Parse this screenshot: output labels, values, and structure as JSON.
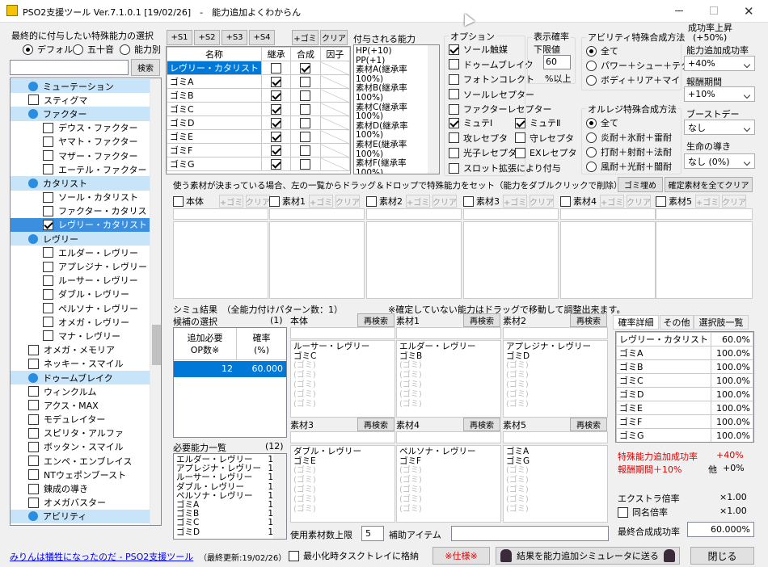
{
  "window": {
    "title": "PSO2支援ツール Ver.7.1.0.1 [19/02/26]　-　能力追加よくわからん"
  },
  "left": {
    "heading": "最終的に付与したい特殊能力の選択",
    "radios": [
      {
        "label": "デフォルト",
        "on": true
      },
      {
        "label": "五十音",
        "on": false
      },
      {
        "label": "能力別",
        "on": false
      }
    ],
    "search_btn": "検索",
    "tree": [
      {
        "t": "cat",
        "l": "ミューテーション"
      },
      {
        "t": "item",
        "l": "スティグマ",
        "c": false,
        "ind": 0
      },
      {
        "t": "cat",
        "l": "ファクター"
      },
      {
        "t": "item",
        "l": "デウス・ファクター",
        "c": false,
        "ind": 1
      },
      {
        "t": "item",
        "l": "ヤマト・ファクター",
        "c": false,
        "ind": 1
      },
      {
        "t": "item",
        "l": "マザー・ファクター",
        "c": false,
        "ind": 1
      },
      {
        "t": "item",
        "l": "エーテル・ファクター",
        "c": false,
        "ind": 1
      },
      {
        "t": "cat",
        "l": "カタリスト"
      },
      {
        "t": "item",
        "l": "ソール・カタリスト",
        "c": false,
        "ind": 1
      },
      {
        "t": "item",
        "l": "ファクター・カタリスト",
        "c": false,
        "ind": 1
      },
      {
        "t": "item",
        "l": "レヴリー・カタリスト",
        "c": true,
        "ind": 1,
        "sel": true
      },
      {
        "t": "cat",
        "l": "レヴリー"
      },
      {
        "t": "item",
        "l": "エルダー・レヴリー",
        "c": false,
        "ind": 1
      },
      {
        "t": "item",
        "l": "アプレジナ・レヴリー",
        "c": false,
        "ind": 1
      },
      {
        "t": "item",
        "l": "ルーサー・レヴリー",
        "c": false,
        "ind": 1
      },
      {
        "t": "item",
        "l": "ダブル・レヴリー",
        "c": false,
        "ind": 1
      },
      {
        "t": "item",
        "l": "ペルソナ・レヴリー",
        "c": false,
        "ind": 1
      },
      {
        "t": "item",
        "l": "オメガ・レヴリー",
        "c": false,
        "ind": 1
      },
      {
        "t": "item",
        "l": "マナ・レヴリー",
        "c": false,
        "ind": 1
      },
      {
        "t": "item",
        "l": "オメガ・メモリア",
        "c": false,
        "ind": 0
      },
      {
        "t": "item",
        "l": "ネッキー・スマイル",
        "c": false,
        "ind": 0
      },
      {
        "t": "cat",
        "l": "ドゥームブレイク"
      },
      {
        "t": "item",
        "l": "ウィンクルム",
        "c": false,
        "ind": 0
      },
      {
        "t": "item",
        "l": "アクス・MAX",
        "c": false,
        "ind": 0
      },
      {
        "t": "item",
        "l": "モデュレイター",
        "c": false,
        "ind": 0
      },
      {
        "t": "item",
        "l": "スピリタ・アルファ",
        "c": false,
        "ind": 0
      },
      {
        "t": "item",
        "l": "ボッタン・スマイル",
        "c": false,
        "ind": 0
      },
      {
        "t": "item",
        "l": "エンペ・エンブレイス",
        "c": false,
        "ind": 0
      },
      {
        "t": "item",
        "l": "NTウェポンブースト",
        "c": false,
        "ind": 0
      },
      {
        "t": "item",
        "l": "錬成の導き",
        "c": false,
        "ind": 0
      },
      {
        "t": "item",
        "l": "オメガバスター",
        "c": false,
        "ind": 0
      },
      {
        "t": "cat",
        "l": "アビリティ"
      }
    ]
  },
  "slots": {
    "buttons": [
      "+S1",
      "+S2",
      "+S3",
      "+S4"
    ],
    "add_gomi": "+ゴミ",
    "clear": "クリア",
    "headers": [
      "名称",
      "継承",
      "合成",
      "因子"
    ],
    "rows": [
      {
        "name": "レヴリー・カタリスト",
        "k": false,
        "g": true,
        "sel": true
      },
      {
        "name": "ゴミA",
        "k": true,
        "g": false
      },
      {
        "name": "ゴミB",
        "k": true,
        "g": false
      },
      {
        "name": "ゴミC",
        "k": true,
        "g": false
      },
      {
        "name": "ゴミD",
        "k": true,
        "g": false
      },
      {
        "name": "ゴミE",
        "k": true,
        "g": false
      },
      {
        "name": "ゴミF",
        "k": true,
        "g": false
      },
      {
        "name": "ゴミG",
        "k": true,
        "g": false
      }
    ]
  },
  "granted": {
    "title": "付与される能力",
    "lines": "HP(+10)\nPP(+1)\n素材A(継承率\n100%)\n素材B(継承率\n100%)\n素材C(継承率\n100%)\n素材D(継承率\n100%)\n素材E(継承率\n100%)\n素材F(継承率\n100%)"
  },
  "options": {
    "title": "オプション",
    "items": [
      {
        "l": "ソール触媒",
        "c": true
      },
      {
        "l": "ドゥームブレイク",
        "c": false
      },
      {
        "l": "フォトンコレクト",
        "c": false
      },
      {
        "l": "ソールレセプター",
        "c": false
      },
      {
        "l": "ファクターレセプター",
        "c": false
      }
    ],
    "pairs": [
      [
        {
          "l": "ミュテⅠ",
          "c": true
        },
        {
          "l": "ミュテⅡ",
          "c": true
        }
      ],
      [
        {
          "l": "攻レセプタ",
          "c": false
        },
        {
          "l": "守レセプタ",
          "c": false
        }
      ],
      [
        {
          "l": "光子レセプタ",
          "c": false
        },
        {
          "l": "EXレセプタ",
          "c": false
        }
      ]
    ],
    "slot_ext": {
      "l": "スロット拡張により付与",
      "c": false
    }
  },
  "prob_limit": {
    "title": "表示確率",
    "sub": "下限値",
    "value": "60",
    "suffix": "%以上"
  },
  "ability_method": {
    "title": "アビリティ特殊合成方法",
    "items": [
      {
        "l": "全て",
        "on": true
      },
      {
        "l": "パワー＋シュー＋テク",
        "on": false
      },
      {
        "l": "ボディ＋リア＋マイ",
        "on": false
      }
    ]
  },
  "orange_method": {
    "title": "オルレジ特殊合成方法",
    "items": [
      {
        "l": "全て",
        "on": true
      },
      {
        "l": "炎耐＋氷耐＋雷耐",
        "on": false
      },
      {
        "l": "打耐＋射耐＋法耐",
        "on": false
      },
      {
        "l": "風耐＋光耐＋闇耐",
        "on": false
      }
    ]
  },
  "boost": {
    "title": "成功率上昇",
    "sub": "(+50%)",
    "add_label": "能力追加成功率",
    "add_value": "+40%",
    "reward_label": "報酬期間",
    "reward_value": "+10%",
    "boostday_label": "ブーストデー",
    "boostday_value": "なし",
    "guide_label": "生命の導き",
    "guide_value": "なし (0%)"
  },
  "materials": {
    "instruction": "使う素材が決まっている場合、左の一覧からドラッグ＆ドロップで特殊能力をセット（能力をダブルクリックで削除）",
    "gomi_fill": "ゴミ埋め",
    "clear_all": "確定素材を全てクリア",
    "cols": [
      {
        "l": "本体"
      },
      {
        "l": "素材1"
      },
      {
        "l": "素材2"
      },
      {
        "l": "素材3"
      },
      {
        "l": "素材4"
      },
      {
        "l": "素材5"
      }
    ],
    "add": "+ゴミ",
    "clr": "クリア"
  },
  "results": {
    "title": "シミュ結果　（全能力付けパターン数：1）",
    "note": "※確定していない能力はドラッグで移動して調整出来ます。",
    "cand_label": "候補の選択",
    "cand_count": "(1)",
    "hdr_op": "追加必要\nOP数※",
    "hdr_rate": "確率\n(%)",
    "row_op": "12",
    "row_rate": "60.000",
    "req_label": "必要能力一覧",
    "req_count": "(12)",
    "req": [
      {
        "n": "エルダー・レヴリー",
        "v": "1"
      },
      {
        "n": "アプレジナ・レヴリー",
        "v": "1"
      },
      {
        "n": "ルーサー・レヴリー",
        "v": "1"
      },
      {
        "n": "ダブル・レヴリー",
        "v": "1"
      },
      {
        "n": "ペルソナ・レヴリー",
        "v": "1"
      },
      {
        "n": "ゴミA",
        "v": "1"
      },
      {
        "n": "ゴミB",
        "v": "1"
      },
      {
        "n": "ゴミC",
        "v": "1"
      },
      {
        "n": "ゴミD",
        "v": "1"
      }
    ],
    "research": "再検索",
    "panels": [
      {
        "l": "本体",
        "lines": []
      },
      {
        "l": "素材1",
        "lines": [
          "エルダー・レヴリー",
          "ゴミB"
        ]
      },
      {
        "l": "素材2",
        "lines": []
      },
      {
        "l": "",
        "lines": []
      },
      {
        "l": "",
        "lines": [
          "ルーサー・レヴリー",
          "ゴミC"
        ]
      },
      {
        "l": "",
        "lines": [
          "アプレジナ・レヴリー",
          "ゴミD"
        ]
      },
      {
        "l": "素材3",
        "lines": [
          "ダブル・レヴリー",
          "ゴミE"
        ]
      },
      {
        "l": "素材4",
        "lines": [
          "ペルソナ・レヴリー",
          "ゴミF"
        ]
      },
      {
        "l": "素材5",
        "lines": [
          "ゴミA",
          "ゴミG"
        ]
      }
    ],
    "ghost": "(ゴミ)",
    "max_label": "使用素材数上限",
    "max_value": "5",
    "aux_label": "補助アイテム"
  },
  "detail": {
    "tabs": [
      "確率詳細",
      "その他",
      "選択肢一覧"
    ],
    "rows": [
      {
        "n": "レヴリー・カタリスト",
        "v": "60.0%"
      },
      {
        "n": "ゴミA",
        "v": "100.0%"
      },
      {
        "n": "ゴミB",
        "v": "100.0%"
      },
      {
        "n": "ゴミC",
        "v": "100.0%"
      },
      {
        "n": "ゴミD",
        "v": "100.0%"
      },
      {
        "n": "ゴミE",
        "v": "100.0%"
      },
      {
        "n": "ゴミF",
        "v": "100.0%"
      },
      {
        "n": "ゴミG",
        "v": "100.0%"
      }
    ],
    "bonus1_l": "特殊能力追加成功率",
    "bonus1_v": "+40%",
    "bonus2_l": "報酬期間＋10%",
    "bonus2_o": "他",
    "bonus2_v": "+0%",
    "extra_l": "エクストラ倍率",
    "extra_v": "×1.00",
    "same_l": "同名倍率",
    "same_v": "×1.00",
    "final_l": "最終合成成功率",
    "final_v": "60.000%"
  },
  "footer": {
    "link": "みりんは犠牲になったのだ - PSO2支援ツール",
    "updated": "（最終更新:19/02/26）",
    "tray": "最小化時タスクトレイに格納",
    "spec": "※仕様※",
    "send": "結果を能力追加シミュレータに送る",
    "close": "閉じる"
  },
  "colors": {
    "accent": "#0078d7",
    "warn": "#e00000",
    "treecat": "#c8e4f8"
  }
}
